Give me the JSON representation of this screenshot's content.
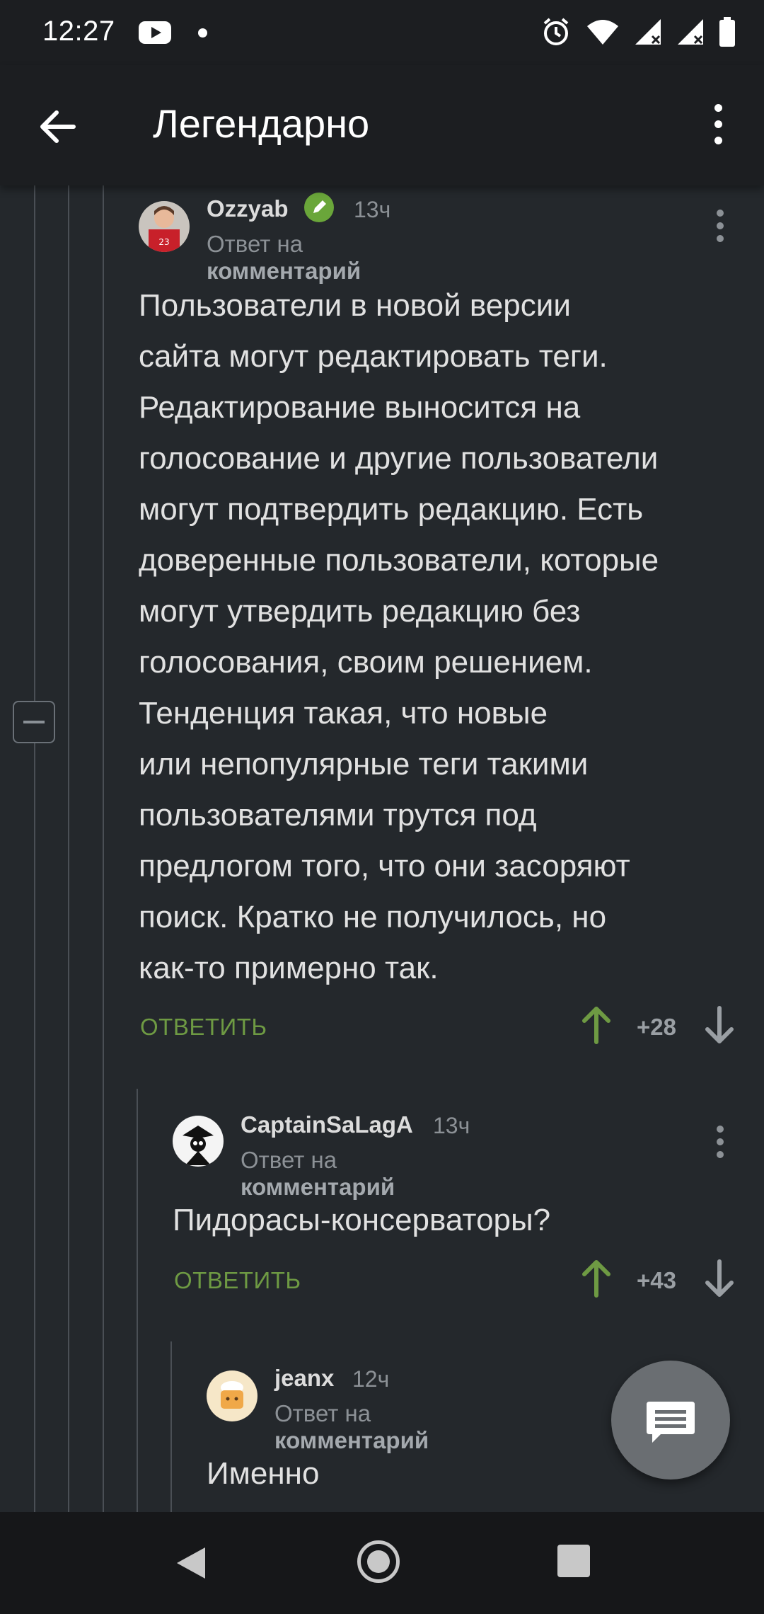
{
  "status_bar": {
    "time": "12:27",
    "icons": [
      "youtube-icon",
      "dot-icon",
      "alarm-icon",
      "wifi-icon",
      "signal-icon",
      "signal-icon",
      "battery-icon"
    ]
  },
  "app_bar": {
    "title": "Легендарно"
  },
  "comments": [
    {
      "author": "Ozzyab",
      "time": "13ч",
      "reply_prefix": "Ответ на",
      "reply_link": "комментарий",
      "text_lines": [
        "Пользователи в новой версии",
        "сайта могут редактировать теги.",
        "Редактирование выносится на",
        "голосование и другие пользователи",
        "могут подтвердить редакцию. Есть",
        "доверенные пользователи, которые",
        "могут утвердить редакцию без",
        "голосования, своим решением.",
        "Тенденция такая, что новые",
        "или непопулярные теги такими",
        "пользователями трутся под",
        "предлогом того, что они засоряют",
        "поиск. Кратко не получилось, но",
        "как-то примерно так."
      ],
      "reply_label": "ОТВЕТИТЬ",
      "score": "+28"
    },
    {
      "author": "CaptainSaLagA",
      "time": "13ч",
      "reply_prefix": "Ответ на",
      "reply_link": "комментарий",
      "text_lines": [
        "Пидорасы-консерваторы?"
      ],
      "reply_label": "ОТВЕТИТЬ",
      "score": "+43"
    },
    {
      "author": "jeanx",
      "time": "12ч",
      "reply_prefix": "Ответ на",
      "reply_link": "комментарий",
      "text_lines": [
        "Именно"
      ]
    }
  ],
  "colors": {
    "background": "#24282c",
    "bar": "#1c1e21",
    "accent_green": "#6e9a43",
    "muted": "#8c9196"
  }
}
